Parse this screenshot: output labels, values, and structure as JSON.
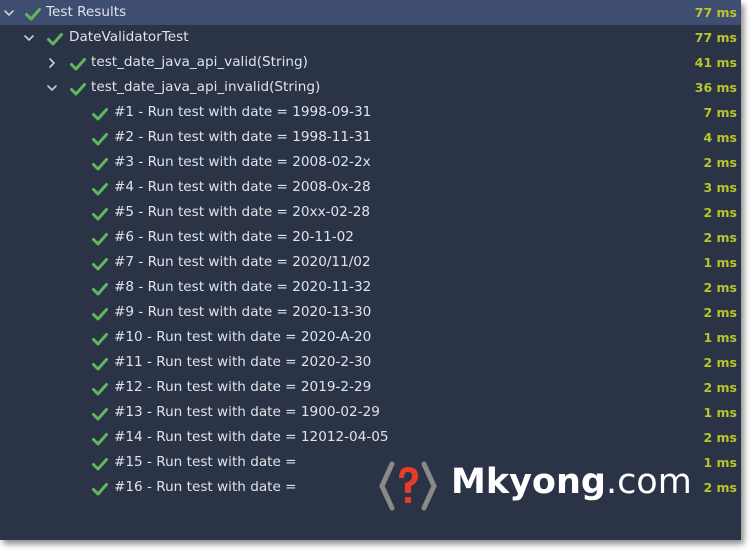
{
  "colors": {
    "panel_bg": "#2b3446",
    "selected_bg": "#3f4d70",
    "check_green": "#5fb85f",
    "time_color": "#b8c52c",
    "logo_red": "#e53c2c"
  },
  "root": {
    "label": "Test Results",
    "time": "77 ms",
    "expanded": true
  },
  "suite": {
    "label": "DateValidatorTest",
    "time": "77 ms",
    "expanded": true
  },
  "methods": [
    {
      "label": "test_date_java_api_valid(String)",
      "time": "41 ms",
      "expanded": false
    },
    {
      "label": "test_date_java_api_invalid(String)",
      "time": "36 ms",
      "expanded": true
    }
  ],
  "tests": [
    {
      "label": "#1 - Run test with date = 1998-09-31",
      "time": "7 ms"
    },
    {
      "label": "#2 - Run test with date = 1998-11-31",
      "time": "4 ms"
    },
    {
      "label": "#3 - Run test with date = 2008-02-2x",
      "time": "2 ms"
    },
    {
      "label": "#4 - Run test with date = 2008-0x-28",
      "time": "3 ms"
    },
    {
      "label": "#5 - Run test with date = 20xx-02-28",
      "time": "2 ms"
    },
    {
      "label": "#6 - Run test with date = 20-11-02",
      "time": "2 ms"
    },
    {
      "label": "#7 - Run test with date = 2020/11/02",
      "time": "1 ms"
    },
    {
      "label": "#8 - Run test with date = 2020-11-32",
      "time": "2 ms"
    },
    {
      "label": "#9 - Run test with date = 2020-13-30",
      "time": "2 ms"
    },
    {
      "label": "#10 - Run test with date = 2020-A-20",
      "time": "1 ms"
    },
    {
      "label": "#11 - Run test with date = 2020-2-30",
      "time": "2 ms"
    },
    {
      "label": "#12 - Run test with date = 2019-2-29",
      "time": "2 ms"
    },
    {
      "label": "#13 - Run test with date = 1900-02-29",
      "time": "1 ms"
    },
    {
      "label": "#14 - Run test with date = 12012-04-05",
      "time": "2 ms"
    },
    {
      "label": "#15 - Run test with date =",
      "time": "1 ms"
    },
    {
      "label": "#16 - Run test with date =",
      "time": "2 ms"
    }
  ],
  "watermark": {
    "brand": "Mkyong",
    "suffix": ".com",
    "icon": "question-mark-icon"
  }
}
